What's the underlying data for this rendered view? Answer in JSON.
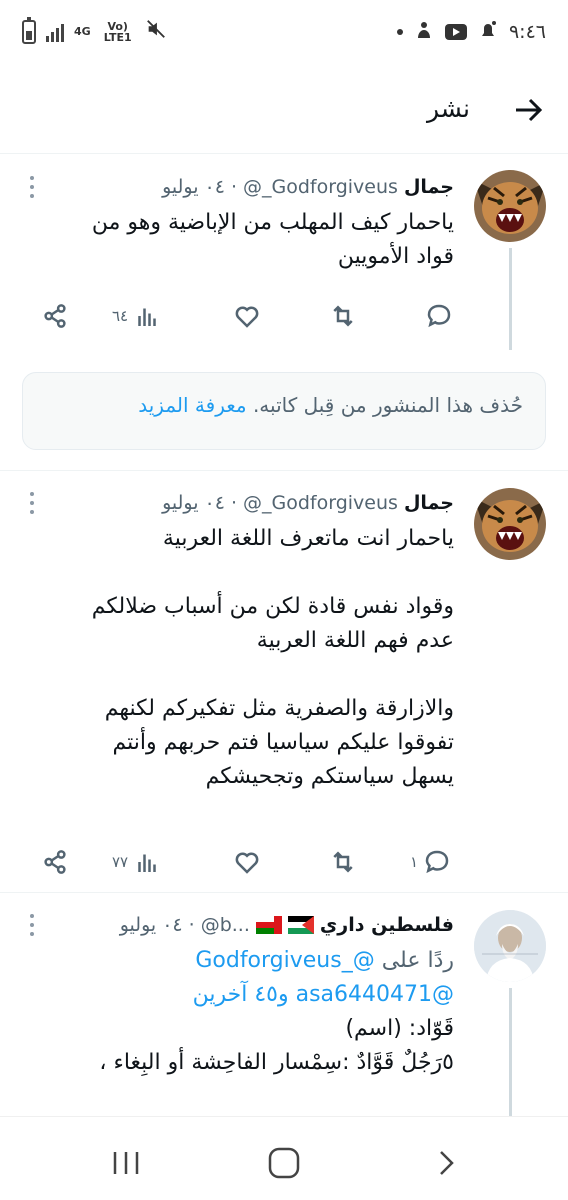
{
  "status_bar": {
    "time": "٩:٤٦",
    "network": "4G",
    "carrier": "Vo) LTE1",
    "icons": [
      "battery-icon",
      "signal-icon",
      "mute-icon",
      "dot-icon",
      "vpn-icon",
      "youtube-icon",
      "notification-icon"
    ]
  },
  "header": {
    "title": "نشر",
    "back_icon": "arrow-right-icon"
  },
  "posts": [
    {
      "name": "جمال",
      "handle": "@_Godforgiveus",
      "dot": "·",
      "date": "٠٤ يوليو",
      "body": [
        "ياحمار كيف المهلب  من الإباضية وهو من",
        "قواد  الأمويين"
      ],
      "reply_count": "",
      "views": "٦٤"
    },
    {
      "name": "جمال",
      "handle": "@_Godforgiveus",
      "dot": "·",
      "date": "٠٤ يوليو",
      "body": [
        "ياحمار انت ماتعرف اللغة العربية",
        "",
        "وقواد نفس قادة   لكن من أسباب ضلالكم",
        "عدم فهم اللغة العربية",
        "",
        "والازارقة والصفرية مثل تفكيركم لكنهم",
        "تفوقوا عليكم سياسيا فتم حربهم  وأنتم",
        "يسهل سياستكم وتجحيشكم"
      ],
      "reply_count": "١",
      "views": "٧٧"
    },
    {
      "name": "فلسطين داري",
      "handle": "@b...",
      "dot": "·",
      "date": "٠٤ يوليو",
      "reply_prefix": "ردًا على",
      "reply_mention_1": "@_Godforgiveus",
      "reply_mention_2": "@asa6440471",
      "reply_and": "و٤٥ آخرين",
      "body": [
        "قَوّاد: (اسم)",
        "٥رَجُلٌ قَوَّادٌ :سِمْسار الفاحِشة أو البِغاء ،"
      ]
    }
  ],
  "deleted_notice": {
    "text": "حُذف هذا المنشور من قِبل كاتبه.",
    "link": "معرفة المزيد"
  },
  "colors": {
    "accent": "#1d9bf0",
    "muted": "#536471",
    "thread_line": "#cfd9de"
  },
  "nav_bar": {
    "icons": [
      "recent-apps-icon",
      "home-icon",
      "back-icon"
    ]
  }
}
